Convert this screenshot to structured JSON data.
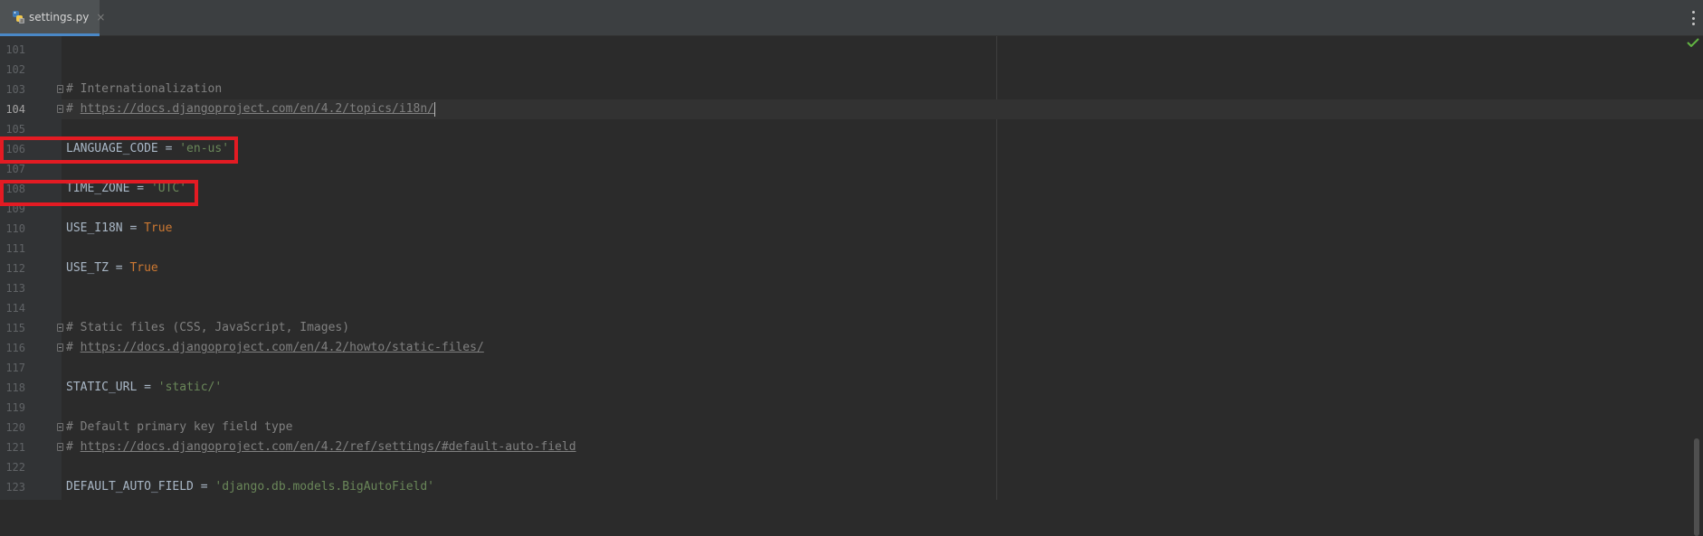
{
  "tab": {
    "label": "settings.py",
    "close": "×",
    "icon": "python-file-icon"
  },
  "status": {
    "inspection_icon": "checkmark-icon",
    "color": "#62b543"
  },
  "colors": {
    "comment": "#808080",
    "string": "#6a8759",
    "keyword": "#cc7832",
    "identifier": "#a9b7c6",
    "highlight": "#e31b23",
    "tab_accent": "#4a88c7"
  },
  "editor": {
    "lines": [
      {
        "n": "101",
        "text": ""
      },
      {
        "n": "102",
        "text": ""
      },
      {
        "n": "103",
        "comment": "# Internationalization"
      },
      {
        "n": "104",
        "prefix": "# ",
        "url": "https://docs.djangoproject.com/en/4.2/topics/i18n/"
      },
      {
        "n": "105",
        "text": ""
      },
      {
        "n": "106",
        "name": "LANGUAGE_CODE",
        "op": " = ",
        "str": "'en-us'"
      },
      {
        "n": "107",
        "text": ""
      },
      {
        "n": "108",
        "name": "TIME_ZONE",
        "op": " = ",
        "str": "'UTC'"
      },
      {
        "n": "109",
        "text": ""
      },
      {
        "n": "110",
        "name": "USE_I18N",
        "op": " = ",
        "kw": "True"
      },
      {
        "n": "111",
        "text": ""
      },
      {
        "n": "112",
        "name": "USE_TZ",
        "op": " = ",
        "kw": "True"
      },
      {
        "n": "113",
        "text": ""
      },
      {
        "n": "114",
        "text": ""
      },
      {
        "n": "115",
        "comment": "# Static files (CSS, JavaScript, Images)"
      },
      {
        "n": "116",
        "prefix": "# ",
        "url": "https://docs.djangoproject.com/en/4.2/howto/static-files/"
      },
      {
        "n": "117",
        "text": ""
      },
      {
        "n": "118",
        "name": "STATIC_URL",
        "op": " = ",
        "str": "'static/'"
      },
      {
        "n": "119",
        "text": ""
      },
      {
        "n": "120",
        "comment": "# Default primary key field type"
      },
      {
        "n": "121",
        "prefix": "# ",
        "url": "https://docs.djangoproject.com/en/4.2/ref/settings/#default-auto-field"
      },
      {
        "n": "122",
        "text": ""
      },
      {
        "n": "123",
        "name": "DEFAULT_AUTO_FIELD",
        "op": " = ",
        "str": "'django.db.models.BigAutoField'"
      }
    ]
  }
}
